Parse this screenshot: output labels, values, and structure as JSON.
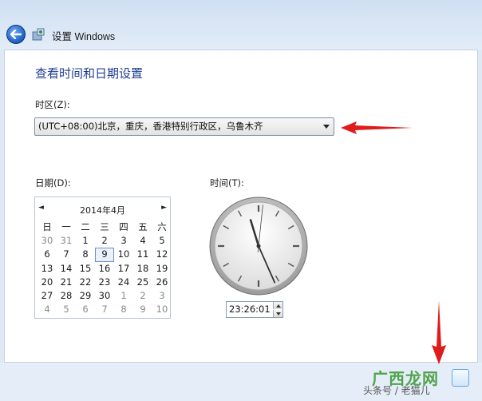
{
  "window": {
    "title": "设置 Windows"
  },
  "page": {
    "heading": "查看时间和日期设置"
  },
  "timezone": {
    "label": "时区(Z):",
    "selected": "(UTC+08:00)北京，重庆，香港特别行政区，乌鲁木齐"
  },
  "date": {
    "label": "日期(D):",
    "month_title": "2014年4月",
    "nav_prev": "◄",
    "nav_next": "►",
    "weekdays": [
      "日",
      "一",
      "二",
      "三",
      "四",
      "五",
      "六"
    ],
    "days": [
      [
        "30",
        "31",
        "1",
        "2",
        "3",
        "4",
        "5"
      ],
      [
        "6",
        "7",
        "8",
        "9",
        "10",
        "11",
        "12"
      ],
      [
        "13",
        "14",
        "15",
        "16",
        "17",
        "18",
        "19"
      ],
      [
        "20",
        "21",
        "22",
        "23",
        "24",
        "25",
        "26"
      ],
      [
        "27",
        "28",
        "29",
        "30",
        "1",
        "2",
        "3"
      ],
      [
        "4",
        "5",
        "6",
        "7",
        "8",
        "9",
        "10"
      ]
    ],
    "selected_day": "9"
  },
  "time": {
    "label": "时间(T):",
    "value": "23:26:01",
    "hour": 23,
    "minute": 26,
    "second": 1
  },
  "watermark": {
    "text": "广西龙网",
    "sub": "头条号 / 老猫儿"
  },
  "colors": {
    "heading": "#1e3d8f",
    "arrow": "#e01b1b",
    "other_month": "#8a8a8a"
  }
}
